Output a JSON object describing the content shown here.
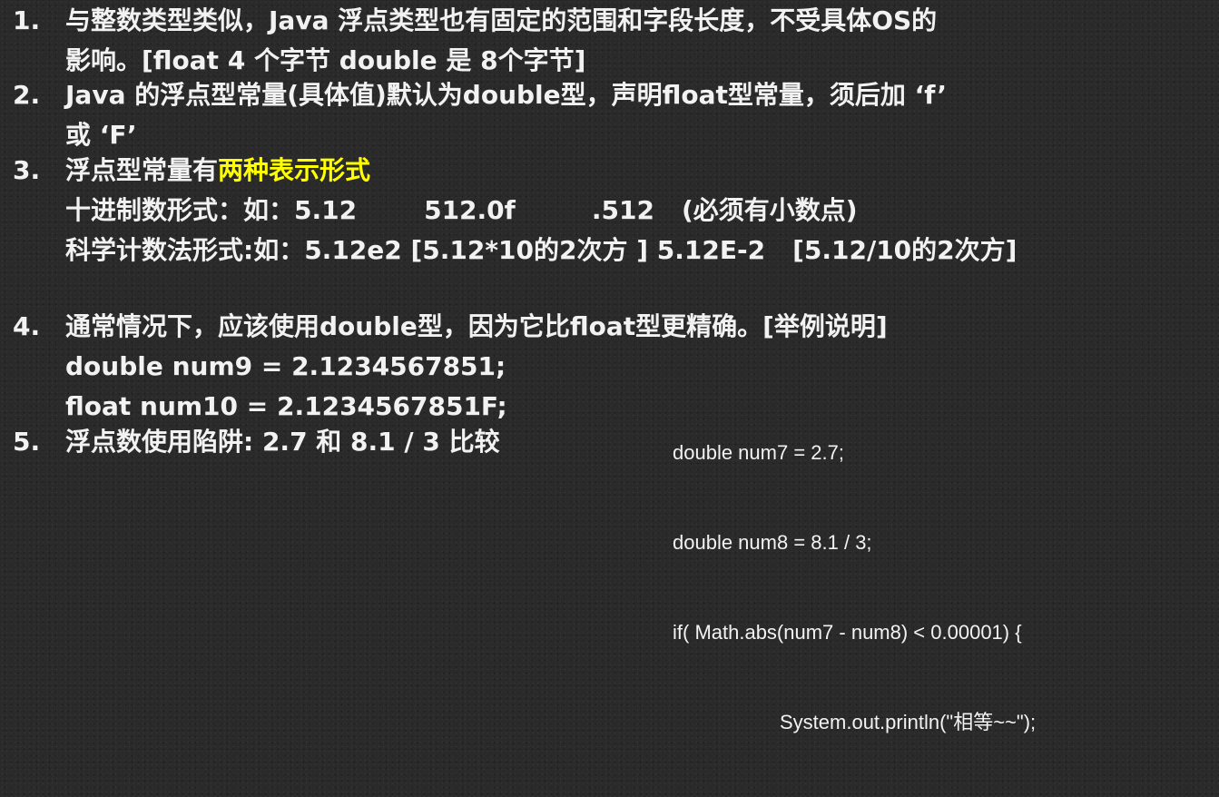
{
  "items": [
    {
      "number": "1.",
      "lines": [
        "与整数类型类似，Java 浮点类型也有固定的范围和字段长度，不受具体OS的",
        "影响。[float 4 个字节 double 是 8个字节]"
      ]
    },
    {
      "number": "2.",
      "lines": [
        "Java 的浮点型常量(具体值)默认为double型，声明float型常量，须后加 ‘f’",
        "或 ‘F’"
      ]
    },
    {
      "number": "3.",
      "title_prefix": "浮点型常量有",
      "title_highlight": "两种表示形式",
      "decimal_label": "十进制数形式：如：5.12",
      "decimal_ex2": "512.0f",
      "decimal_ex3": ".512",
      "decimal_note": "(必须有小数点)",
      "sci_label": "科学计数法形式:如：5.12e2 [5.12*10的2次方 ] 5.12E-2",
      "sci_note": "[5.12/10的2次方]"
    },
    {
      "number": "4.",
      "lines": [
        "通常情况下，应该使用double型，因为它比float型更精确。[举例说明]",
        "double num9 = 2.1234567851;",
        "float num10 =  2.1234567851F;"
      ]
    },
    {
      "number": "5.",
      "lines": [
        "浮点数使用陷阱: 2.7 和 8.1 / 3  比较"
      ]
    }
  ],
  "code": [
    "double num7 = 2.7;",
    "double num8 = 8.1 / 3;",
    "if( Math.abs(num7 - num8) < 0.00001) {",
    "System.out.println(\"相等~~\");"
  ],
  "colors": {
    "background": "#2a2a2a",
    "text": "#f2f2f2",
    "highlight": "#ffff00"
  }
}
